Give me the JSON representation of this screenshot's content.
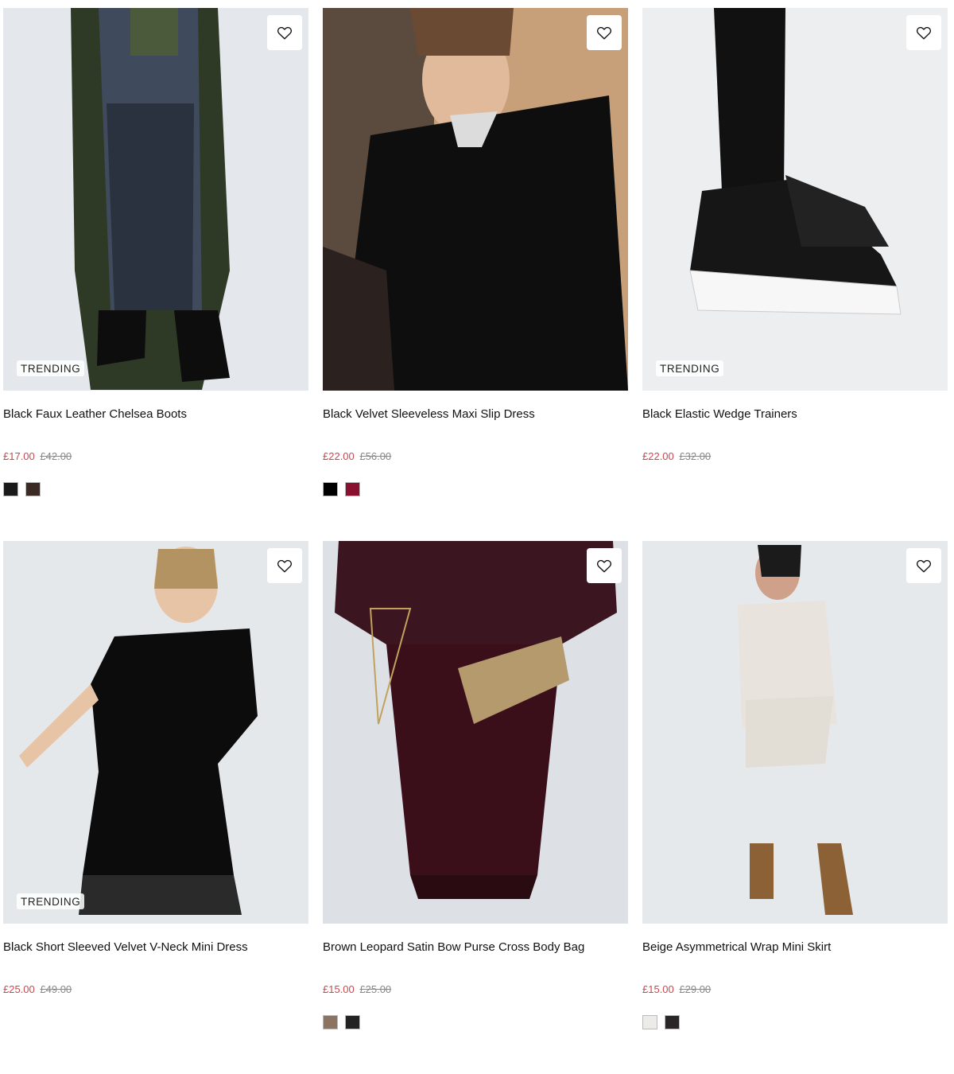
{
  "products": [
    {
      "title": "Black Faux Leather Chelsea Boots",
      "sale_price": "£17.00",
      "was_price": "£42.00",
      "badge": "TRENDING",
      "swatches": [
        "#1a1a1a",
        "#3b2b24"
      ]
    },
    {
      "title": "Black Velvet Sleeveless Maxi Slip Dress",
      "sale_price": "£22.00",
      "was_price": "£56.00",
      "badge": "",
      "swatches": [
        "#000000",
        "#8a1030"
      ]
    },
    {
      "title": "Black Elastic Wedge Trainers",
      "sale_price": "£22.00",
      "was_price": "£32.00",
      "badge": "TRENDING",
      "swatches": []
    },
    {
      "title": "Black Short Sleeved Velvet V-Neck Mini Dress",
      "sale_price": "£25.00",
      "was_price": "£49.00",
      "badge": "TRENDING",
      "swatches": []
    },
    {
      "title": "Brown Leopard Satin Bow Purse Cross Body Bag",
      "sale_price": "£15.00",
      "was_price": "£25.00",
      "badge": "",
      "swatches": [
        "#8b7560",
        "#222222"
      ]
    },
    {
      "title": "Beige Asymmetrical Wrap Mini Skirt",
      "sale_price": "£15.00",
      "was_price": "£29.00",
      "badge": "",
      "swatches": [
        "#ecebe8",
        "#2b2528"
      ]
    }
  ],
  "icons": {
    "wishlist": "heart-outline-icon"
  },
  "colors": {
    "sale": "#c9484f",
    "was": "#888888"
  }
}
